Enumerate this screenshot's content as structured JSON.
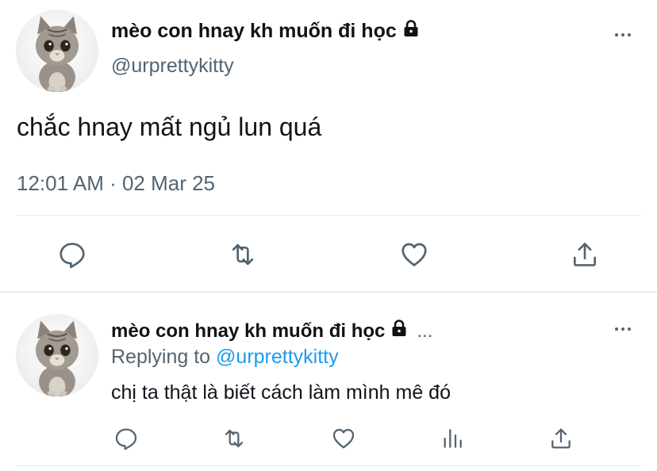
{
  "main_tweet": {
    "display_name": "mèo con hnay kh muốn đi học",
    "handle": "@urprettykitty",
    "text": "chắc hnay mất ngủ lun quá",
    "timestamp": "12:01 AM · 02 Mar 25",
    "actions": [
      "reply-icon",
      "retweet-icon",
      "like-icon",
      "share-icon"
    ]
  },
  "reply_tweet": {
    "display_name": "mèo con hnay kh muốn đi học",
    "ellipsis": "...",
    "replying_prefix": "Replying to",
    "replying_handle": "@urprettykitty",
    "text": "chị ta thật là biết cách làm mình mê đó",
    "actions": [
      "reply-icon",
      "retweet-icon",
      "like-icon",
      "views-icon",
      "share-icon"
    ]
  },
  "colors": {
    "text": "#0f1419",
    "secondary": "#536471",
    "accent": "#1d9bf0",
    "divider": "#e6ecf0"
  }
}
